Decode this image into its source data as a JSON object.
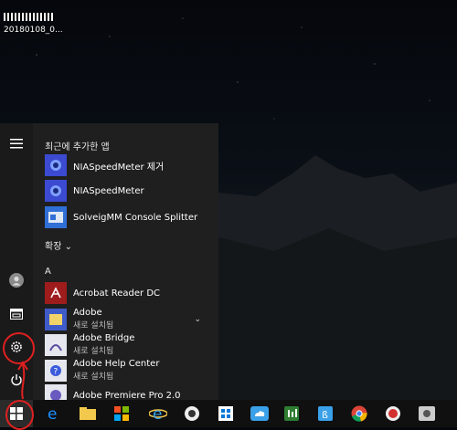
{
  "desktop": {
    "icon_label": "20180108_0...",
    "icon_thumb": "filmstrip-thumbnail"
  },
  "start_menu": {
    "recent_title": "최근에 추가한 앱",
    "recent_apps": [
      {
        "label": "NIASpeedMeter 제거",
        "icon": "niaspeedmeter-uninstall-icon"
      },
      {
        "label": "NIASpeedMeter",
        "icon": "niaspeedmeter-icon"
      },
      {
        "label": "SolveigMM Console Splitter",
        "icon": "solveigmm-icon"
      }
    ],
    "expand_label": "확장",
    "section_a": "A",
    "apps": [
      {
        "label": "Acrobat Reader DC",
        "sub": "",
        "icon": "acrobat-icon"
      },
      {
        "label": "Adobe",
        "sub": "새로 설치됨",
        "icon": "folder-icon"
      },
      {
        "label": "Adobe Bridge",
        "sub": "새로 설치됨",
        "icon": "adobe-bridge-icon"
      },
      {
        "label": "Adobe Help Center",
        "sub": "새로 설치됨",
        "icon": "adobe-help-icon"
      },
      {
        "label": "Adobe Premiere Pro 2.0",
        "sub": "",
        "icon": "premiere-icon"
      }
    ],
    "rail": [
      "hamburger-icon",
      "user-icon",
      "pictures-icon",
      "settings-icon",
      "power-icon"
    ]
  },
  "taskbar": {
    "items": [
      "start-icon",
      "edge-icon",
      "file-explorer-icon",
      "store-icon",
      "ie-icon",
      "app-icon",
      "windows-logo-icon",
      "cloud-icon",
      "spreadsheet-icon",
      "notes-icon",
      "chrome-icon",
      "record-icon",
      "camera-app-icon"
    ]
  },
  "colors": {
    "annotation": "#e02020",
    "menu_bg": "#1f1f1f",
    "accent_tile": "#3b5bdb"
  }
}
